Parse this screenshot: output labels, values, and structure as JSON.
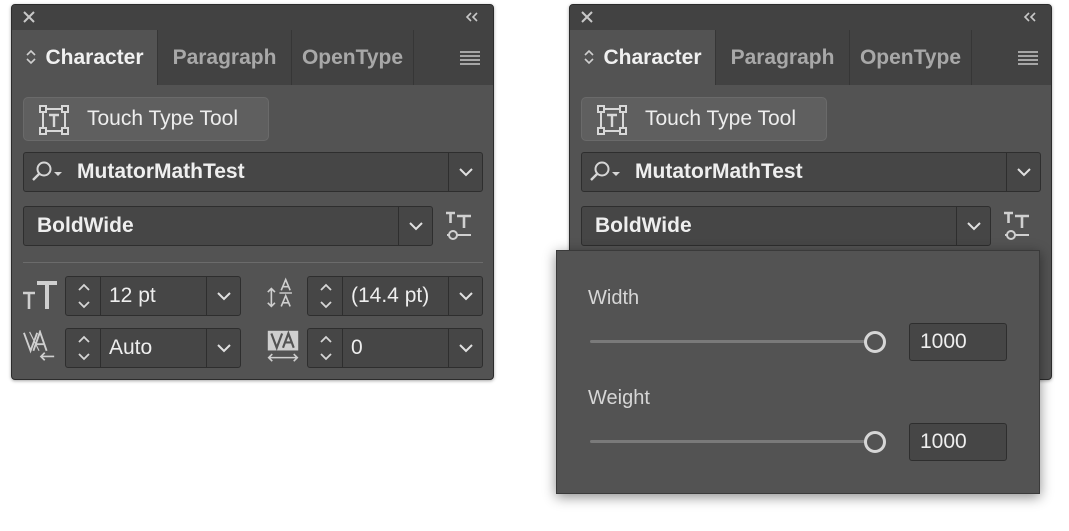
{
  "panels": [
    {
      "id": "left",
      "tabs": [
        "Character",
        "Paragraph",
        "OpenType"
      ],
      "active_tab": "Character",
      "touch_type_label": "Touch Type Tool",
      "font_family": "MutatorMathTest",
      "font_style": "BoldWide",
      "font_size": "12 pt",
      "leading": "(14.4 pt)",
      "kerning": "Auto",
      "tracking": "0"
    },
    {
      "id": "right",
      "tabs": [
        "Character",
        "Paragraph",
        "OpenType"
      ],
      "active_tab": "Character",
      "touch_type_label": "Touch Type Tool",
      "font_family": "MutatorMathTest",
      "font_style": "BoldWide"
    }
  ],
  "variable_font_popover": {
    "axes": [
      {
        "label": "Width",
        "value": "1000",
        "slider_fraction": 1.0
      },
      {
        "label": "Weight",
        "value": "1000",
        "slider_fraction": 1.0
      }
    ]
  },
  "icons": [
    "close-icon",
    "collapse-icon",
    "panel-menu-icon",
    "tab-order-icon",
    "touch-type-icon",
    "search-icon",
    "variable-font-icon",
    "font-size-icon",
    "leading-icon",
    "kerning-icon",
    "tracking-icon"
  ],
  "colors": {
    "panel_bg": "#535353",
    "titlebar_bg": "#424242",
    "field_bg": "#464646",
    "text_active": "#f0f0f0",
    "text_inactive": "#a8a8a8"
  }
}
